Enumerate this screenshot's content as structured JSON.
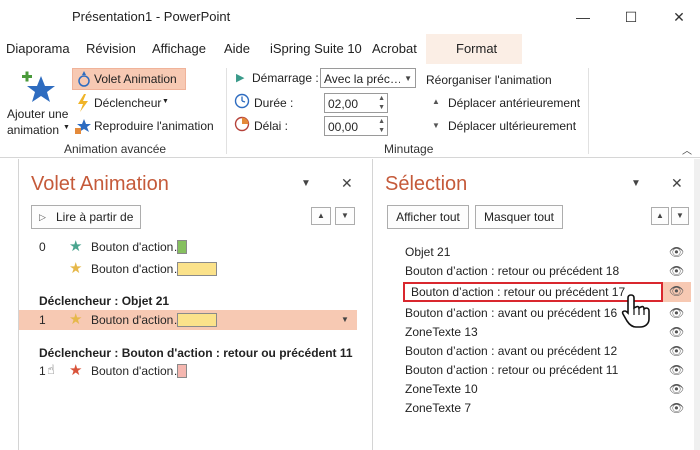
{
  "window": {
    "title": "Présentation1  -  PowerPoint",
    "min_glyph": "—",
    "max_glyph": "☐",
    "close_glyph": "✕"
  },
  "tabs": [
    "Diaporama",
    "Révision",
    "Affichage",
    "Aide",
    "iSpring Suite 10",
    "Acrobat",
    "Format"
  ],
  "ribbon": {
    "add_animation_line1": "Ajouter une",
    "add_animation_line2": "animation",
    "animation_pane": "Volet Animation",
    "trigger": "Déclencheur",
    "animation_painter": "Reproduire l'animation",
    "group_advanced": "Animation avancée",
    "start_label": "Démarrage :",
    "start_value": "Avec la préc…",
    "duration_label": "Durée :",
    "duration_value": "02,00",
    "delay_label": "Délai :",
    "delay_value": "00,00",
    "reorder_title": "Réorganiser l'animation",
    "move_earlier": "Déplacer antérieurement",
    "move_later": "Déplacer ultérieurement",
    "group_timing": "Minutage"
  },
  "animation_pane": {
    "title": "Volet Animation",
    "play_button": "Lire à partir de",
    "rows": [
      {
        "num": "0",
        "label": "Bouton d'action…",
        "star_color": "#4aa58f",
        "bar_color": "#86c05f"
      },
      {
        "num": "",
        "label": "Bouton d'action…",
        "star_color": "#e6b84a",
        "bar_color": "#fbe28a"
      },
      {
        "num": "1",
        "label": "Bouton d'action…",
        "star_color": "#e6b84a",
        "bar_color": "#fbe28a"
      },
      {
        "num": "1",
        "label": "Bouton d'action…",
        "star_color": "#d9533a",
        "bar_color": "#f5b7b0"
      }
    ],
    "trigger1": "Déclencheur : Objet 21",
    "trigger2": "Déclencheur : Bouton d'action : retour ou précédent 11"
  },
  "selection_pane": {
    "title": "Sélection",
    "show_all": "Afficher tout",
    "hide_all": "Masquer tout",
    "items": [
      "Objet 21",
      "Bouton d’action : retour ou précédent 18",
      "Bouton d’action : retour ou précédent 17",
      "Bouton d’action : avant ou précédent 16",
      "ZoneTexte 13",
      "Bouton d’action : avant ou précédent 12",
      "Bouton d’action : retour ou précédent 11",
      "ZoneTexte 10",
      "ZoneTexte 7"
    ]
  },
  "colors": {
    "accent": "#c55a3a",
    "highlight": "#f7c9b3",
    "edit_border": "#d9272e"
  }
}
